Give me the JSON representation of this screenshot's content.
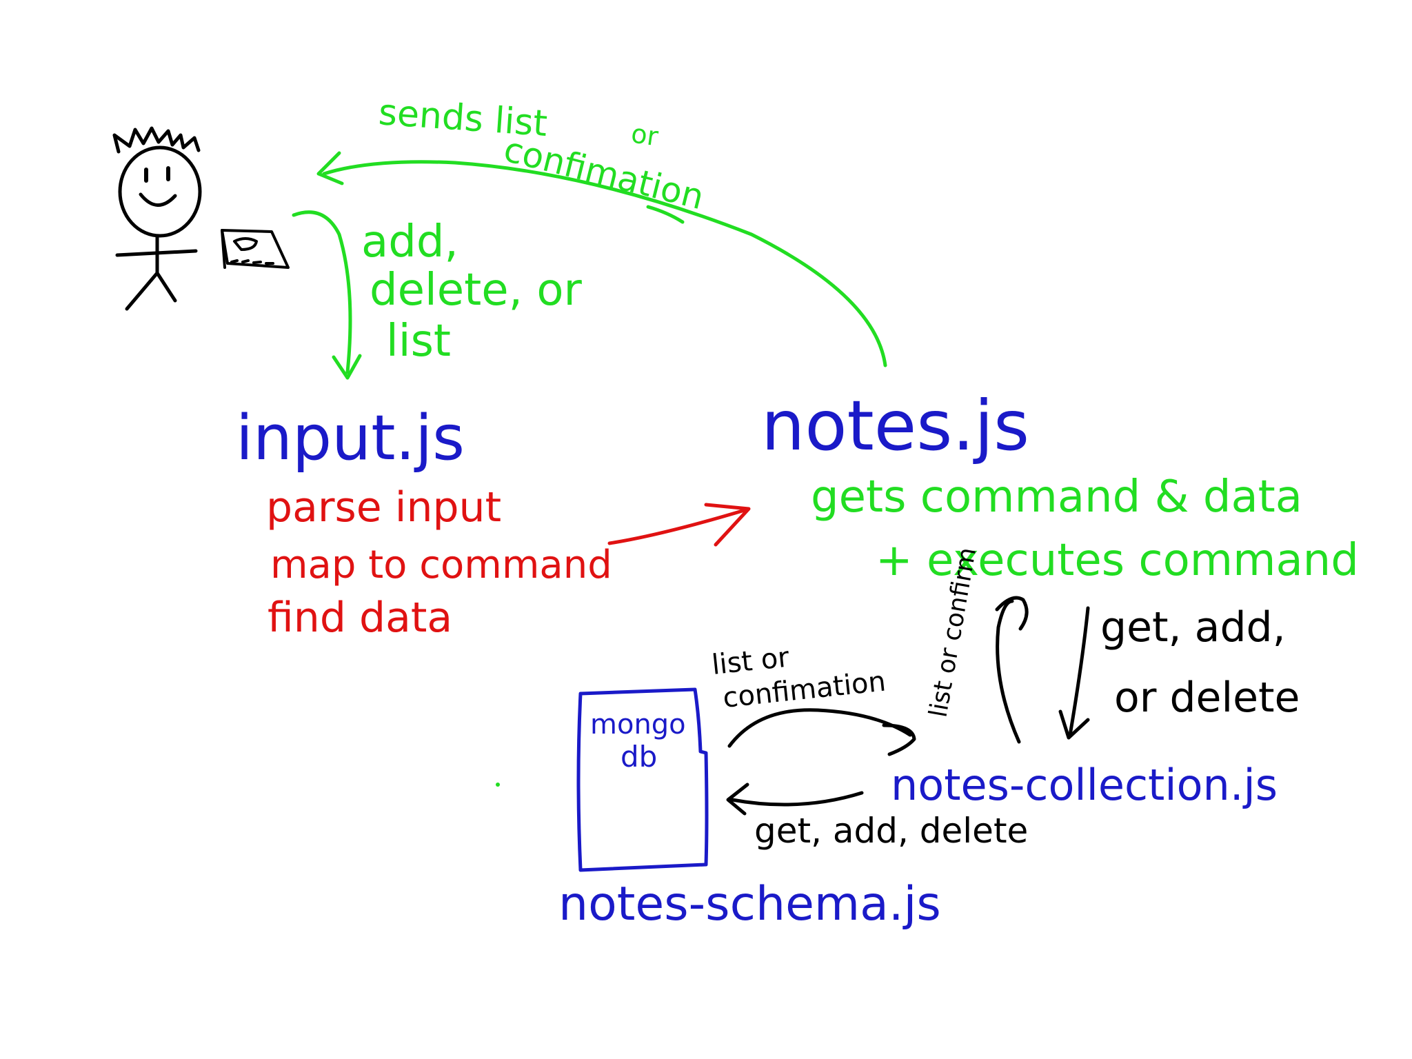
{
  "colors": {
    "background": "#ffffff",
    "green": "#22dd22",
    "blue": "#1a1ac8",
    "red": "#e01212",
    "black": "#000000"
  },
  "labels": {
    "sends_list_line1": "sends list",
    "sends_list_line2": "or",
    "sends_list_line3": "confimation",
    "user_command_line1": "add,",
    "user_command_line2": "delete, or",
    "user_command_line3": "list",
    "input_module": "input.js",
    "input_step1": "parse input",
    "input_step2": "map to command",
    "input_step3": "find data",
    "notes_module": "notes.js",
    "notes_desc1": "gets command & data",
    "notes_desc2": "+ executes command",
    "vertical_return": "list or confirm",
    "collection_ops_line1": "get, add,",
    "collection_ops_line2": "or delete",
    "db_return_line1": "list  or",
    "db_return_line2": "confimation",
    "db_label_line1": "mongo",
    "db_label_line2": "db",
    "db_ops": "get, add, delete",
    "collection_module": "notes-collection.js",
    "schema_module": "notes-schema.js"
  },
  "icons": {
    "user": "stick-figure-icon",
    "device": "laptop-icon",
    "database": "database-box-icon"
  }
}
